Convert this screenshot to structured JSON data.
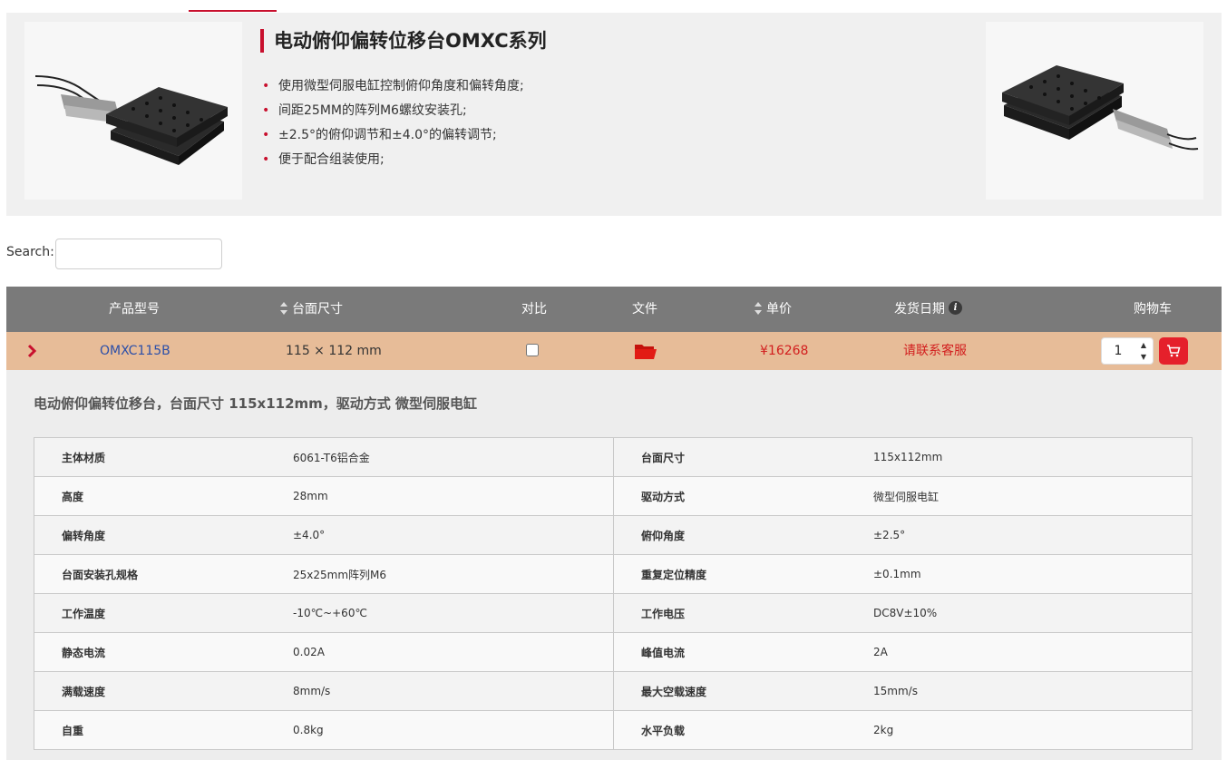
{
  "hero": {
    "title": "电动俯仰偏转位移台OMXC系列",
    "features": [
      "使用微型伺服电缸控制俯仰角度和偏转角度;",
      "间距25MM的阵列M6螺纹安装孔;",
      "±2.5°的俯仰调节和±4.0°的偏转调节;",
      "便于配合组装使用;"
    ]
  },
  "search": {
    "label": "Search:",
    "placeholder": ""
  },
  "table": {
    "headers": {
      "model": "产品型号",
      "size": "台面尺寸",
      "compare": "对比",
      "file": "文件",
      "price": "单价",
      "ship": "发货日期",
      "cart": "购物车"
    },
    "row": {
      "model": "OMXC115B",
      "size": "115 × 112 mm",
      "price": "¥16268",
      "ship": "请联系客服",
      "qty": "1"
    }
  },
  "details": {
    "title": "电动俯仰偏转位移台，台面尺寸 115x112mm，驱动方式 微型伺服电缸",
    "specs": [
      [
        "主体材质",
        "6061-T6铝合金",
        "台面尺寸",
        "115x112mm"
      ],
      [
        "高度",
        "28mm",
        "驱动方式",
        "微型伺服电缸"
      ],
      [
        "偏转角度",
        "±4.0°",
        "俯仰角度",
        "±2.5°"
      ],
      [
        "台面安装孔规格",
        "25x25mm阵列M6",
        "重复定位精度",
        "±0.1mm"
      ],
      [
        "工作温度",
        "-10℃~+60℃",
        "工作电压",
        "DC8V±10%"
      ],
      [
        "静态电流",
        "0.02A",
        "峰值电流",
        "2A"
      ],
      [
        "满载速度",
        "8mm/s",
        "最大空载速度",
        "15mm/s"
      ],
      [
        "自重",
        "0.8kg",
        "水平负载",
        "2kg"
      ]
    ]
  },
  "colors": {
    "accent": "#c8102e",
    "row_highlight": "#e7bc98",
    "header_bg": "#7a7a7a",
    "price": "#d21e1e"
  }
}
